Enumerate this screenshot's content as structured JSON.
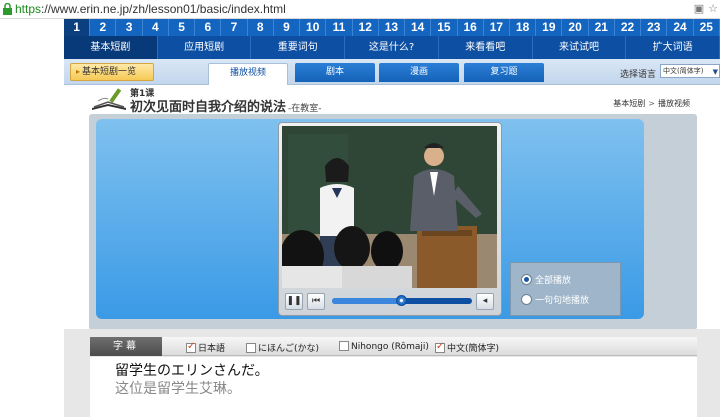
{
  "browser": {
    "url_scheme": "https",
    "url_rest": "://www.erin.ne.jp/zh/lesson01/basic/index.html"
  },
  "lesson_numbers": [
    "1",
    "2",
    "3",
    "4",
    "5",
    "6",
    "7",
    "8",
    "9",
    "10",
    "11",
    "12",
    "13",
    "14",
    "15",
    "16",
    "17",
    "18",
    "19",
    "20",
    "21",
    "22",
    "23",
    "24",
    "25"
  ],
  "active_lesson_index": 0,
  "categories": [
    "基本短剧",
    "应用短剧",
    "重要词句",
    "这是什么?",
    "来看看吧",
    "来试试吧",
    "扩大词语"
  ],
  "subnav": {
    "back_label": "基本短剧一览",
    "tabs": [
      "播放视频",
      "剧本",
      "漫画",
      "复习题"
    ],
    "language_label": "选择语言",
    "language_value": "中文(简体字)"
  },
  "lesson": {
    "number": "第1课",
    "title": "初次见面时自我介绍的说法",
    "subtitle": "-在教室-",
    "breadcrumb": [
      "基本短剧",
      "播放视频"
    ]
  },
  "player": {
    "progress": 0.5
  },
  "playback_mode": {
    "options": [
      "全部播放",
      "一句句地播放"
    ],
    "selected": 0
  },
  "subtitles": {
    "header": "字幕",
    "options": [
      {
        "label": "日本語",
        "checked": true
      },
      {
        "label": "にほんご(かな)",
        "checked": false
      },
      {
        "label": "Nihongo (Rômaji)",
        "checked": false
      },
      {
        "label": "中文(簡体字)",
        "checked": true
      }
    ],
    "line_jp": "留学生のエリンさんだ。",
    "line_zh": "这位是留学生艾琳。"
  }
}
